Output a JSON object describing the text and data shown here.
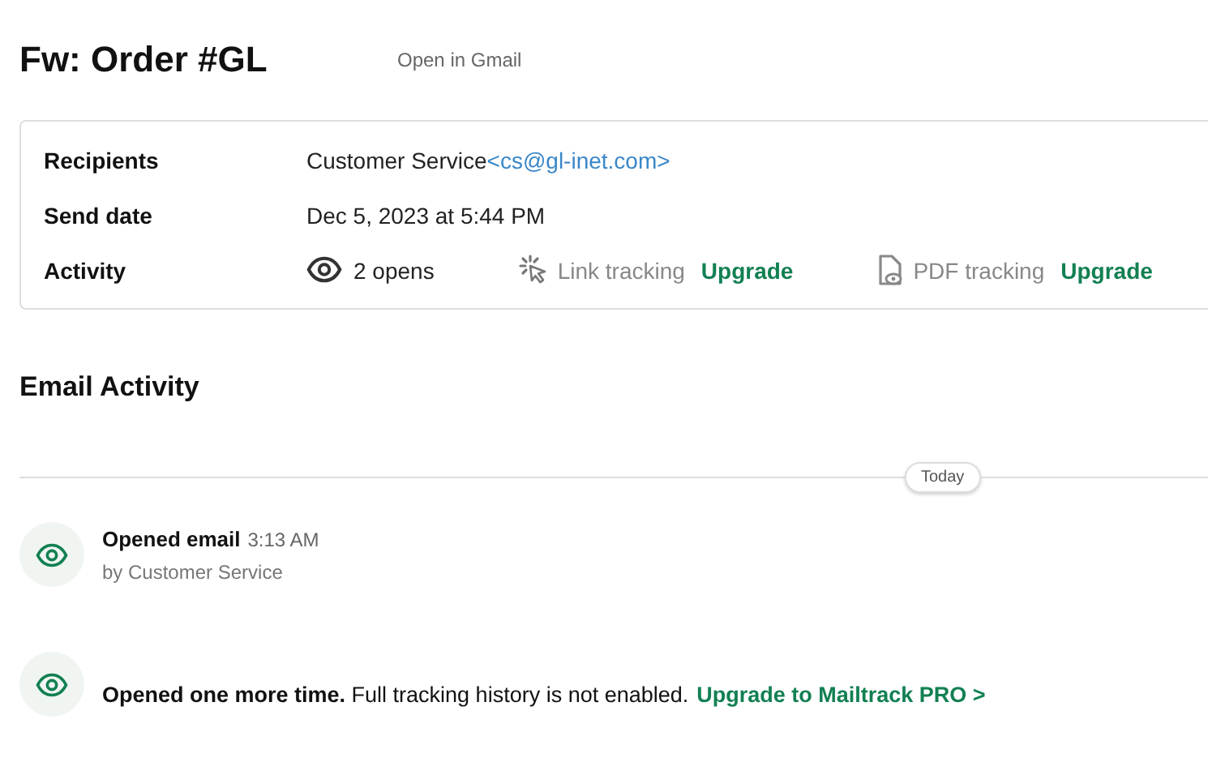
{
  "title": "Fw: Order #GL",
  "open_link": "Open in Gmail",
  "details": {
    "recipients": {
      "label": "Recipients",
      "name": "Customer Service",
      "email": "<cs@gl-inet.com>"
    },
    "send_date": {
      "label": "Send date",
      "value": "Dec 5, 2023 at 5:44 PM"
    },
    "activity": {
      "label": "Activity",
      "opens": "2 opens",
      "features": [
        {
          "kind": "link",
          "label": "Link tracking",
          "action": "Upgrade"
        },
        {
          "kind": "pdf",
          "label": "PDF tracking",
          "action": "Upgrade"
        }
      ]
    }
  },
  "section_title": "Email Activity",
  "day_label": "Today",
  "events": [
    {
      "kind": "opened",
      "title": "Opened email",
      "time": "3:13 AM",
      "by": "by Customer Service"
    },
    {
      "kind": "notice",
      "text": "**Opened one more time.** Full tracking history is not enabled.",
      "link": "Upgrade to Mailtrack PRO >"
    }
  ]
}
